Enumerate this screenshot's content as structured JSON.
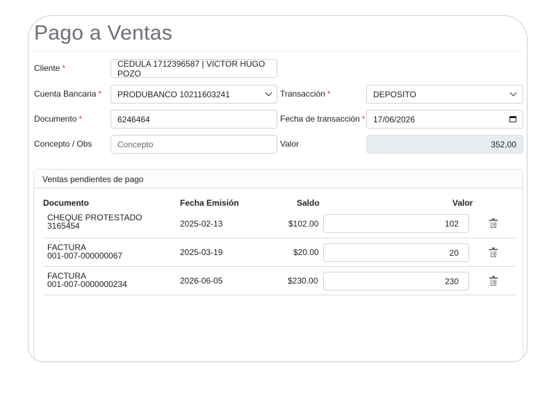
{
  "title": "Pago a Ventas",
  "form": {
    "cliente": {
      "label": "Cliente",
      "required": "*",
      "value": "CEDULA 1712396587 | VICTOR HUGO POZO"
    },
    "cuenta": {
      "label": "Cuenta Bancaria",
      "required": "*",
      "value": "PRODUBANCO 10211603241"
    },
    "transaccion": {
      "label": "Transacción",
      "required": "*",
      "value": "DEPOSITO"
    },
    "documento": {
      "label": "Documento",
      "required": "*",
      "value": "6246464"
    },
    "fecha": {
      "label": "Fecha de transacción",
      "required": "*",
      "value": "17/06/2026"
    },
    "concepto": {
      "label": "Concepto / Obs",
      "placeholder": "Concepto"
    },
    "valor": {
      "label": "Valor",
      "value": "352,00"
    }
  },
  "ventas": {
    "title": "Ventas pendientes de pago",
    "headers": {
      "documento": "Documento",
      "fecha": "Fecha Emisión",
      "saldo": "Saldo",
      "valor": "Valor"
    },
    "rows": [
      {
        "doc_type": "CHEQUE PROTESTADO",
        "doc_num": "3165454",
        "fecha": "2025-02-13",
        "saldo": "$102.00",
        "valor": "102"
      },
      {
        "doc_type": "FACTURA",
        "doc_num": "001-007-000000067",
        "fecha": "2025-03-19",
        "saldo": "$20.00",
        "valor": "20"
      },
      {
        "doc_type": "FACTURA",
        "doc_num": "001-007-0000000234",
        "fecha": "2026-06-05",
        "saldo": "$230.00",
        "valor": "230"
      }
    ]
  },
  "icons": {
    "delete": "trash-icon",
    "dropdown": "chevron-down-icon",
    "date": "calendar-icon"
  }
}
